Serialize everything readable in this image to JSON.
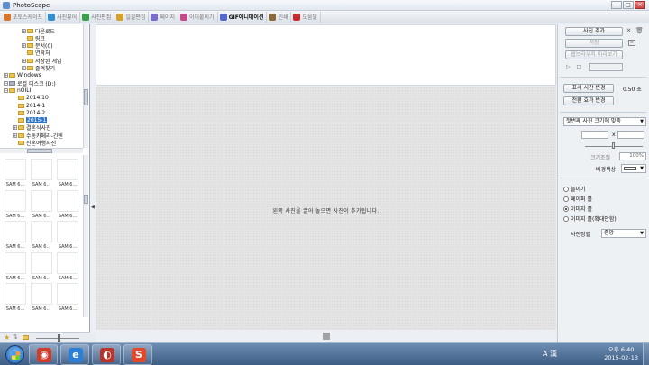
{
  "window": {
    "title": "PhotoScape",
    "minimize": "–",
    "maximize": "□",
    "close": "✕"
  },
  "tabs": [
    {
      "label": "포토스케이프",
      "color": "#d9762b"
    },
    {
      "label": "사진뷰어",
      "color": "#2f8fd0"
    },
    {
      "label": "사진편집",
      "color": "#3aa04a"
    },
    {
      "label": "일괄편집",
      "color": "#d4a22a"
    },
    {
      "label": "페이지",
      "color": "#7a6bd0"
    },
    {
      "label": "이어붙이기",
      "color": "#c24a8b"
    },
    {
      "label": "GIF애니메이션",
      "color": "#5566cc"
    },
    {
      "label": "인쇄",
      "color": "#8a6a3a"
    },
    {
      "label": "도움말",
      "color": "#cc2a2a"
    }
  ],
  "active_tab": "GIF애니메이션",
  "folder_tree": [
    {
      "label": "다운로드",
      "indent": 2,
      "expander": "+",
      "icon": "folder"
    },
    {
      "label": "링크",
      "indent": 2,
      "expander": "",
      "icon": "folder"
    },
    {
      "label": "문서(0)",
      "indent": 2,
      "expander": "+",
      "icon": "folder"
    },
    {
      "label": "연락처",
      "indent": 2,
      "expander": "",
      "icon": "folder"
    },
    {
      "label": "저장된 게임",
      "indent": 2,
      "expander": "+",
      "icon": "folder"
    },
    {
      "label": "즐겨찾기",
      "indent": 2,
      "expander": "+",
      "icon": "folder"
    },
    {
      "label": "Windows",
      "indent": 0,
      "expander": "+",
      "icon": "folder"
    },
    {
      "label": "로컬 디스크 (D:)",
      "indent": 0,
      "expander": "-",
      "icon": "drive"
    },
    {
      "label": "nOILI",
      "indent": 0,
      "expander": "-",
      "icon": "folder"
    },
    {
      "label": "2014.10",
      "indent": 1,
      "expander": "",
      "icon": "folder"
    },
    {
      "label": "2014-1",
      "indent": 1,
      "expander": "",
      "icon": "folder"
    },
    {
      "label": "2014-2",
      "indent": 1,
      "expander": "",
      "icon": "folder"
    },
    {
      "label": "2015-1",
      "indent": 1,
      "expander": "",
      "icon": "folder",
      "selected": true
    },
    {
      "label": "결혼식사진",
      "indent": 1,
      "expander": "+",
      "icon": "folder"
    },
    {
      "label": "수동카메라-긴텐",
      "indent": 1,
      "expander": "+",
      "icon": "folder"
    },
    {
      "label": "신혼여행사진",
      "indent": 1,
      "expander": "",
      "icon": "folder"
    }
  ],
  "thumbnails": [
    "SAM 6...",
    "SAM 6...",
    "SAM 6...",
    "SAM 6...",
    "SAM 6...",
    "SAM 6...",
    "SAM 6...",
    "SAM 6...",
    "SAM 6...",
    "SAM 6...",
    "SAM 6...",
    "SAM 6...",
    "SAM 6...",
    "SAM 6...",
    "SAM 6..."
  ],
  "canvas": {
    "hint": "왼쪽 사진을 끌어 놓으면 사진이 추가됩니다."
  },
  "right_panel": {
    "add_photo": "사진 추가",
    "save": "저장",
    "preview": "웹브라우저 미리보기",
    "change_time": "표시 시간 변경",
    "time_value": "0.50 초",
    "change_effect": "전환 효과 변경",
    "size_select": "첫번째 사진 크기에 맞춤",
    "size_x": "x",
    "zoom_label": "크기조절",
    "zoom_value": "100%",
    "bg_color_label": "배경색상",
    "bg_color": "#ffffff",
    "fit_options": [
      {
        "label": "늘이기",
        "checked": false
      },
      {
        "label": "페이퍼 홀",
        "checked": false
      },
      {
        "label": "이미지 홀",
        "checked": true
      },
      {
        "label": "이미지 홀(확대안함)",
        "checked": false
      }
    ],
    "align_label": "사진정렬",
    "align_value": "중앙"
  },
  "taskbar": {
    "apps": [
      {
        "name": "photoscape-app",
        "glyph": "◉",
        "color": "#d23a2a"
      },
      {
        "name": "internet-explorer",
        "glyph": "e",
        "color": "#2a7fd8"
      },
      {
        "name": "chrome-app",
        "glyph": "◐",
        "color": "#b8342a"
      },
      {
        "name": "slideshow-app",
        "glyph": "S",
        "color": "#e04a2a"
      }
    ],
    "ime": "A 漢",
    "time": "오후 6:40",
    "date": "2015-02-13"
  }
}
